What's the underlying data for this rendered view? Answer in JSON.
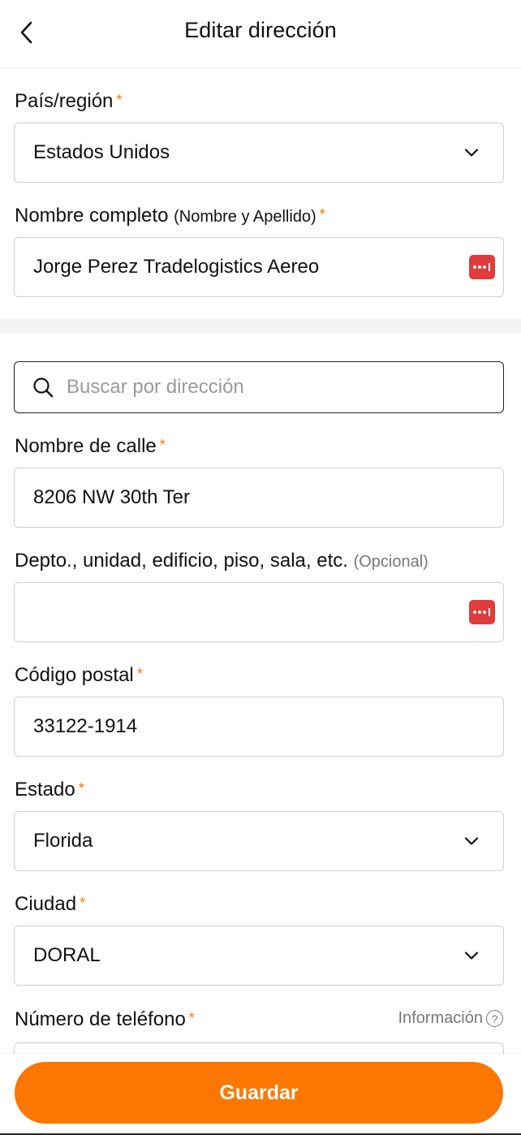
{
  "header": {
    "title": "Editar dirección",
    "back_icon": "chevron-left-icon"
  },
  "country": {
    "label": "País/región",
    "required": "*",
    "value": "Estados Unidos",
    "icon": "chevron-down-icon"
  },
  "full_name": {
    "label": "Nombre completo",
    "sublabel": "(Nombre y Apellido)",
    "required": "*",
    "value": "Jorge Perez Tradelogistics Aereo",
    "autofill_icon": "password-manager-icon"
  },
  "search": {
    "placeholder": "Buscar por dirección",
    "icon": "search-icon"
  },
  "street": {
    "label": "Nombre de calle",
    "required": "*",
    "value": "8206 NW 30th Ter"
  },
  "unit": {
    "label": "Depto., unidad, edificio, piso, sala, etc.",
    "optional": "(Opcional)",
    "value": "",
    "autofill_icon": "password-manager-icon"
  },
  "postal": {
    "label": "Código postal",
    "required": "*",
    "value": "33122-1914"
  },
  "state": {
    "label": "Estado",
    "required": "*",
    "value": "Florida",
    "icon": "chevron-down-icon"
  },
  "city": {
    "label": "Ciudad",
    "required": "*",
    "value": "DORAL",
    "icon": "chevron-down-icon"
  },
  "phone": {
    "label": "Número de teléfono",
    "required": "*",
    "info_label": "Información",
    "info_icon": "?"
  },
  "footer": {
    "save_label": "Guardar"
  },
  "colors": {
    "accent": "#fb7701",
    "autofill": "#e13b3b"
  }
}
